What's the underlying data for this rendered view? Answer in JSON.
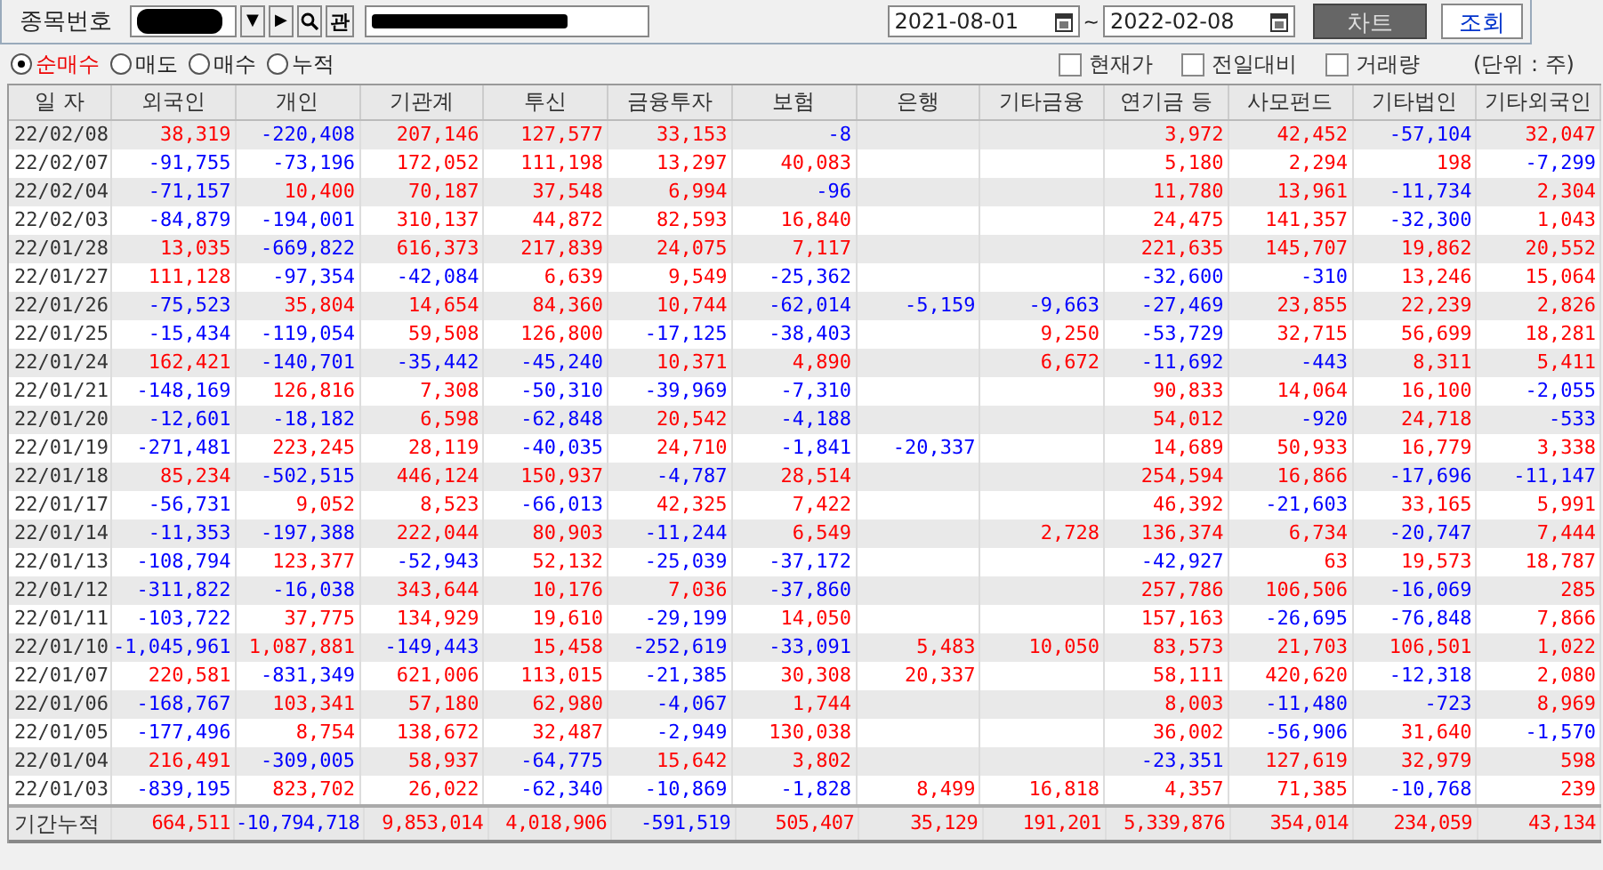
{
  "toolbar": {
    "code_label": "종목번호",
    "dropdown_glyph": "▼",
    "next_glyph": "▶",
    "related_label": "관",
    "date_from": "2021-08-01",
    "date_separator": "~",
    "date_to": "2022-02-08",
    "chart_button": "차트",
    "query_button": "조회"
  },
  "options": [
    {
      "label": "순매수",
      "selected": true
    },
    {
      "label": "매도",
      "selected": false
    },
    {
      "label": "매수",
      "selected": false
    },
    {
      "label": "누적",
      "selected": false
    }
  ],
  "checkboxes": [
    {
      "label": "현재가",
      "checked": false
    },
    {
      "label": "전일대비",
      "checked": false
    },
    {
      "label": "거래량",
      "checked": false
    }
  ],
  "unit_note": "(단위 : 주)",
  "table": {
    "columns": [
      "일 자",
      "외국인",
      "개인",
      "기관계",
      "투신",
      "금융투자",
      "보험",
      "은행",
      "기타금융",
      "연기금 등",
      "사모펀드",
      "기타법인",
      "기타외국인"
    ],
    "rows": [
      {
        "date": "22/02/08",
        "foreign": "38,319",
        "individual": "-220,408",
        "institutions": "207,146",
        "investment_trust": "127,577",
        "financial_investment": "33,153",
        "insurance": "-8",
        "pension": "3,972",
        "private_fund": "42,452",
        "other_corp": "-57,104",
        "other_foreign": "32,047"
      },
      {
        "date": "22/02/07",
        "foreign": "-91,755",
        "individual": "-73,196",
        "institutions": "172,052",
        "investment_trust": "111,198",
        "financial_investment": "13,297",
        "insurance": "40,083",
        "pension": "5,180",
        "private_fund": "2,294",
        "other_corp": "198",
        "other_foreign": "-7,299"
      },
      {
        "date": "22/02/04",
        "foreign": "-71,157",
        "individual": "10,400",
        "institutions": "70,187",
        "investment_trust": "37,548",
        "financial_investment": "6,994",
        "insurance": "-96",
        "pension": "11,780",
        "private_fund": "13,961",
        "other_corp": "-11,734",
        "other_foreign": "2,304"
      },
      {
        "date": "22/02/03",
        "foreign": "-84,879",
        "individual": "-194,001",
        "institutions": "310,137",
        "investment_trust": "44,872",
        "financial_investment": "82,593",
        "insurance": "16,840",
        "pension": "24,475",
        "private_fund": "141,357",
        "other_corp": "-32,300",
        "other_foreign": "1,043"
      },
      {
        "date": "22/01/28",
        "foreign": "13,035",
        "individual": "-669,822",
        "institutions": "616,373",
        "investment_trust": "217,839",
        "financial_investment": "24,075",
        "insurance": "7,117",
        "pension": "221,635",
        "private_fund": "145,707",
        "other_corp": "19,862",
        "other_foreign": "20,552"
      },
      {
        "date": "22/01/27",
        "foreign": "111,128",
        "individual": "-97,354",
        "institutions": "-42,084",
        "investment_trust": "6,639",
        "financial_investment": "9,549",
        "insurance": "-25,362",
        "pension": "-32,600",
        "private_fund": "-310",
        "other_corp": "13,246",
        "other_foreign": "15,064"
      },
      {
        "date": "22/01/26",
        "foreign": "-75,523",
        "individual": "35,804",
        "institutions": "14,654",
        "investment_trust": "84,360",
        "financial_investment": "10,744",
        "insurance": "-62,014",
        "bank": "-5,159",
        "other_finance": "-9,663",
        "pension": "-27,469",
        "private_fund": "23,855",
        "other_corp": "22,239",
        "other_foreign": "2,826"
      },
      {
        "date": "22/01/25",
        "foreign": "-15,434",
        "individual": "-119,054",
        "institutions": "59,508",
        "investment_trust": "126,800",
        "financial_investment": "-17,125",
        "insurance": "-38,403",
        "other_finance": "9,250",
        "pension": "-53,729",
        "private_fund": "32,715",
        "other_corp": "56,699",
        "other_foreign": "18,281"
      },
      {
        "date": "22/01/24",
        "foreign": "162,421",
        "individual": "-140,701",
        "institutions": "-35,442",
        "investment_trust": "-45,240",
        "financial_investment": "10,371",
        "insurance": "4,890",
        "other_finance": "6,672",
        "pension": "-11,692",
        "private_fund": "-443",
        "other_corp": "8,311",
        "other_foreign": "5,411"
      },
      {
        "date": "22/01/21",
        "foreign": "-148,169",
        "individual": "126,816",
        "institutions": "7,308",
        "investment_trust": "-50,310",
        "financial_investment": "-39,969",
        "insurance": "-7,310",
        "pension": "90,833",
        "private_fund": "14,064",
        "other_corp": "16,100",
        "other_foreign": "-2,055"
      },
      {
        "date": "22/01/20",
        "foreign": "-12,601",
        "individual": "-18,182",
        "institutions": "6,598",
        "investment_trust": "-62,848",
        "financial_investment": "20,542",
        "insurance": "-4,188",
        "pension": "54,012",
        "private_fund": "-920",
        "other_corp": "24,718",
        "other_foreign": "-533"
      },
      {
        "date": "22/01/19",
        "foreign": "-271,481",
        "individual": "223,245",
        "institutions": "28,119",
        "investment_trust": "-40,035",
        "financial_investment": "24,710",
        "insurance": "-1,841",
        "bank": "-20,337",
        "pension": "14,689",
        "private_fund": "50,933",
        "other_corp": "16,779",
        "other_foreign": "3,338"
      },
      {
        "date": "22/01/18",
        "foreign": "85,234",
        "individual": "-502,515",
        "institutions": "446,124",
        "investment_trust": "150,937",
        "financial_investment": "-4,787",
        "insurance": "28,514",
        "pension": "254,594",
        "private_fund": "16,866",
        "other_corp": "-17,696",
        "other_foreign": "-11,147"
      },
      {
        "date": "22/01/17",
        "foreign": "-56,731",
        "individual": "9,052",
        "institutions": "8,523",
        "investment_trust": "-66,013",
        "financial_investment": "42,325",
        "insurance": "7,422",
        "pension": "46,392",
        "private_fund": "-21,603",
        "other_corp": "33,165",
        "other_foreign": "5,991"
      },
      {
        "date": "22/01/14",
        "foreign": "-11,353",
        "individual": "-197,388",
        "institutions": "222,044",
        "investment_trust": "80,903",
        "financial_investment": "-11,244",
        "insurance": "6,549",
        "other_finance": "2,728",
        "pension": "136,374",
        "private_fund": "6,734",
        "other_corp": "-20,747",
        "other_foreign": "7,444"
      },
      {
        "date": "22/01/13",
        "foreign": "-108,794",
        "individual": "123,377",
        "institutions": "-52,943",
        "investment_trust": "52,132",
        "financial_investment": "-25,039",
        "insurance": "-37,172",
        "pension": "-42,927",
        "private_fund": "63",
        "other_corp": "19,573",
        "other_foreign": "18,787"
      },
      {
        "date": "22/01/12",
        "foreign": "-311,822",
        "individual": "-16,038",
        "institutions": "343,644",
        "investment_trust": "10,176",
        "financial_investment": "7,036",
        "insurance": "-37,860",
        "pension": "257,786",
        "private_fund": "106,506",
        "other_corp": "-16,069",
        "other_foreign": "285"
      },
      {
        "date": "22/01/11",
        "foreign": "-103,722",
        "individual": "37,775",
        "institutions": "134,929",
        "investment_trust": "19,610",
        "financial_investment": "-29,199",
        "insurance": "14,050",
        "pension": "157,163",
        "private_fund": "-26,695",
        "other_corp": "-76,848",
        "other_foreign": "7,866"
      },
      {
        "date": "22/01/10",
        "foreign": "-1,045,961",
        "individual": "1,087,881",
        "institutions": "-149,443",
        "investment_trust": "15,458",
        "financial_investment": "-252,619",
        "insurance": "-33,091",
        "bank": "5,483",
        "other_finance": "10,050",
        "pension": "83,573",
        "private_fund": "21,703",
        "other_corp": "106,501",
        "other_foreign": "1,022"
      },
      {
        "date": "22/01/07",
        "foreign": "220,581",
        "individual": "-831,349",
        "institutions": "621,006",
        "investment_trust": "113,015",
        "financial_investment": "-21,385",
        "insurance": "30,308",
        "bank": "20,337",
        "pension": "58,111",
        "private_fund": "420,620",
        "other_corp": "-12,318",
        "other_foreign": "2,080"
      },
      {
        "date": "22/01/06",
        "foreign": "-168,767",
        "individual": "103,341",
        "institutions": "57,180",
        "investment_trust": "62,980",
        "financial_investment": "-4,067",
        "insurance": "1,744",
        "pension": "8,003",
        "private_fund": "-11,480",
        "other_corp": "-723",
        "other_foreign": "8,969"
      },
      {
        "date": "22/01/05",
        "foreign": "-177,496",
        "individual": "8,754",
        "institutions": "138,672",
        "investment_trust": "32,487",
        "financial_investment": "-2,949",
        "insurance": "130,038",
        "pension": "36,002",
        "private_fund": "-56,906",
        "other_corp": "31,640",
        "other_foreign": "-1,570"
      },
      {
        "date": "22/01/04",
        "foreign": "216,491",
        "individual": "-309,005",
        "institutions": "58,937",
        "investment_trust": "-64,775",
        "financial_investment": "15,642",
        "insurance": "3,802",
        "pension": "-23,351",
        "private_fund": "127,619",
        "other_corp": "32,979",
        "other_foreign": "598"
      },
      {
        "date": "22/01/03",
        "foreign": "-839,195",
        "individual": "823,702",
        "institutions": "26,022",
        "investment_trust": "-62,340",
        "financial_investment": "-10,869",
        "insurance": "-1,828",
        "bank": "8,499",
        "other_finance": "16,818",
        "pension": "4,357",
        "private_fund": "71,385",
        "other_corp": "-10,768",
        "other_foreign": "239"
      }
    ],
    "total": {
      "date": "기간누적",
      "foreign": "664,511",
      "individual": "-10,794,718",
      "institutions": "9,853,014",
      "investment_trust": "4,018,906",
      "financial_investment": "-591,519",
      "insurance": "505,407",
      "bank": "35,129",
      "other_finance": "191,201",
      "pension": "5,339,876",
      "private_fund": "354,014",
      "other_corp": "234,059",
      "other_foreign": "43,134"
    }
  }
}
